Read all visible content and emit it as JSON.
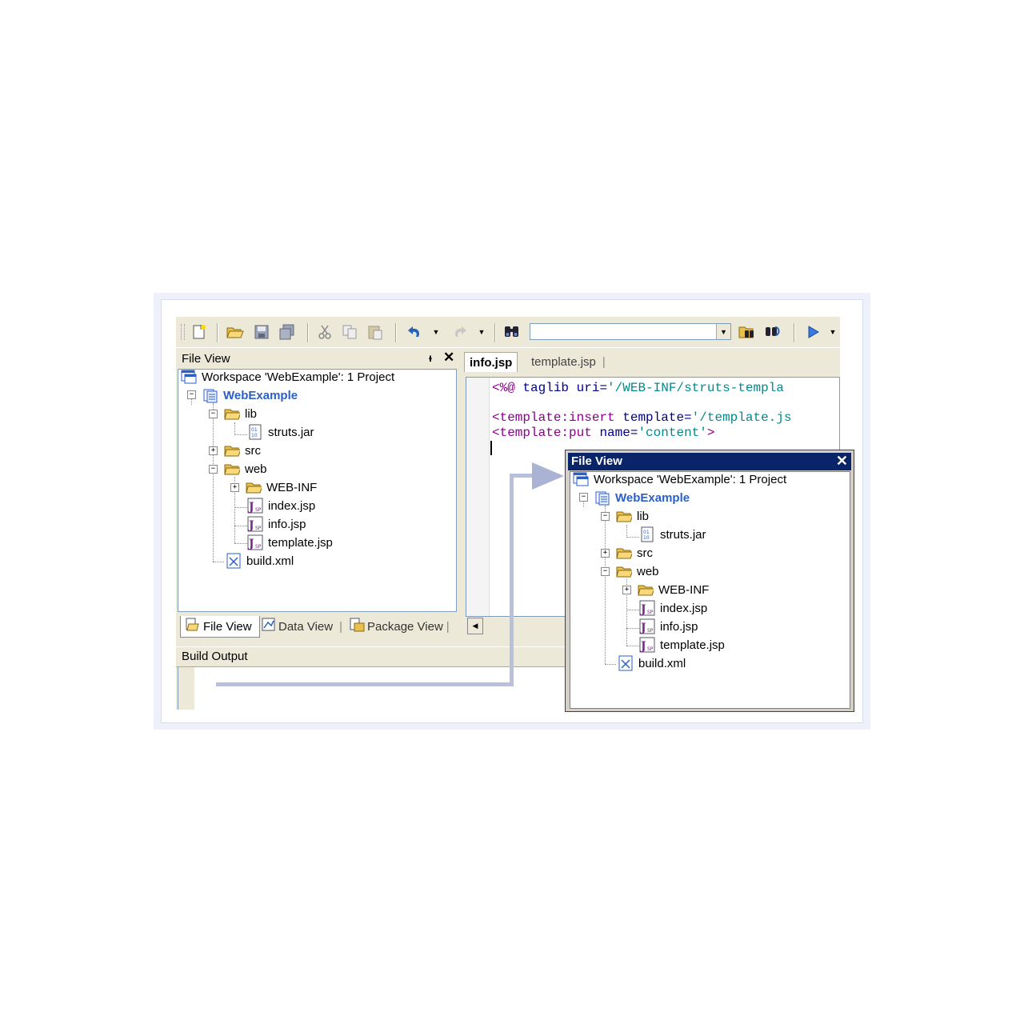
{
  "toolbar": {
    "icons": [
      "new-file-icon",
      "open-folder-icon",
      "save-icon",
      "save-all-icon",
      "cut-icon",
      "copy-icon",
      "paste-icon",
      "undo-icon",
      "redo-icon",
      "find-icon",
      "find-in-files-icon",
      "replace-icon",
      "run-icon"
    ],
    "search_value": ""
  },
  "file_view": {
    "title": "File View",
    "pin": "ᵻ",
    "close": "✕",
    "tree": {
      "workspace": "Workspace 'WebExample': 1 Project",
      "project": "WebExample",
      "lib": "lib",
      "struts_jar": "struts.jar",
      "src": "src",
      "web": "web",
      "web_inf": "WEB-INF",
      "index_jsp": "index.jsp",
      "info_jsp": "info.jsp",
      "template_jsp": "template.jsp",
      "build_xml": "build.xml"
    },
    "bottom_tabs": [
      "File View",
      "Data View",
      "Package View"
    ]
  },
  "editor": {
    "tabs": [
      "info.jsp",
      "template.jsp"
    ],
    "active_tab": "info.jsp",
    "code": {
      "line1_delim": "<%@",
      "line1_kw": "taglib",
      "line1_attr": "uri=",
      "line1_val": "'/WEB-INF/struts-templa",
      "line3_tag": "<template:insert",
      "line3_attr": "template=",
      "line3_val": "'/template.js",
      "line4_tag": "<template:put",
      "line4_attr": "name=",
      "line4_val": "'content'",
      "line4_end": ">"
    }
  },
  "build_output": {
    "title": "Build Output"
  },
  "floating_file_view": {
    "title": "File View",
    "close": "✕"
  },
  "colors": {
    "tag": "#8b008b",
    "attr": "#00008b",
    "value": "#008b8b",
    "project": "#2a5fc8",
    "titlebar": "#0a246a"
  }
}
